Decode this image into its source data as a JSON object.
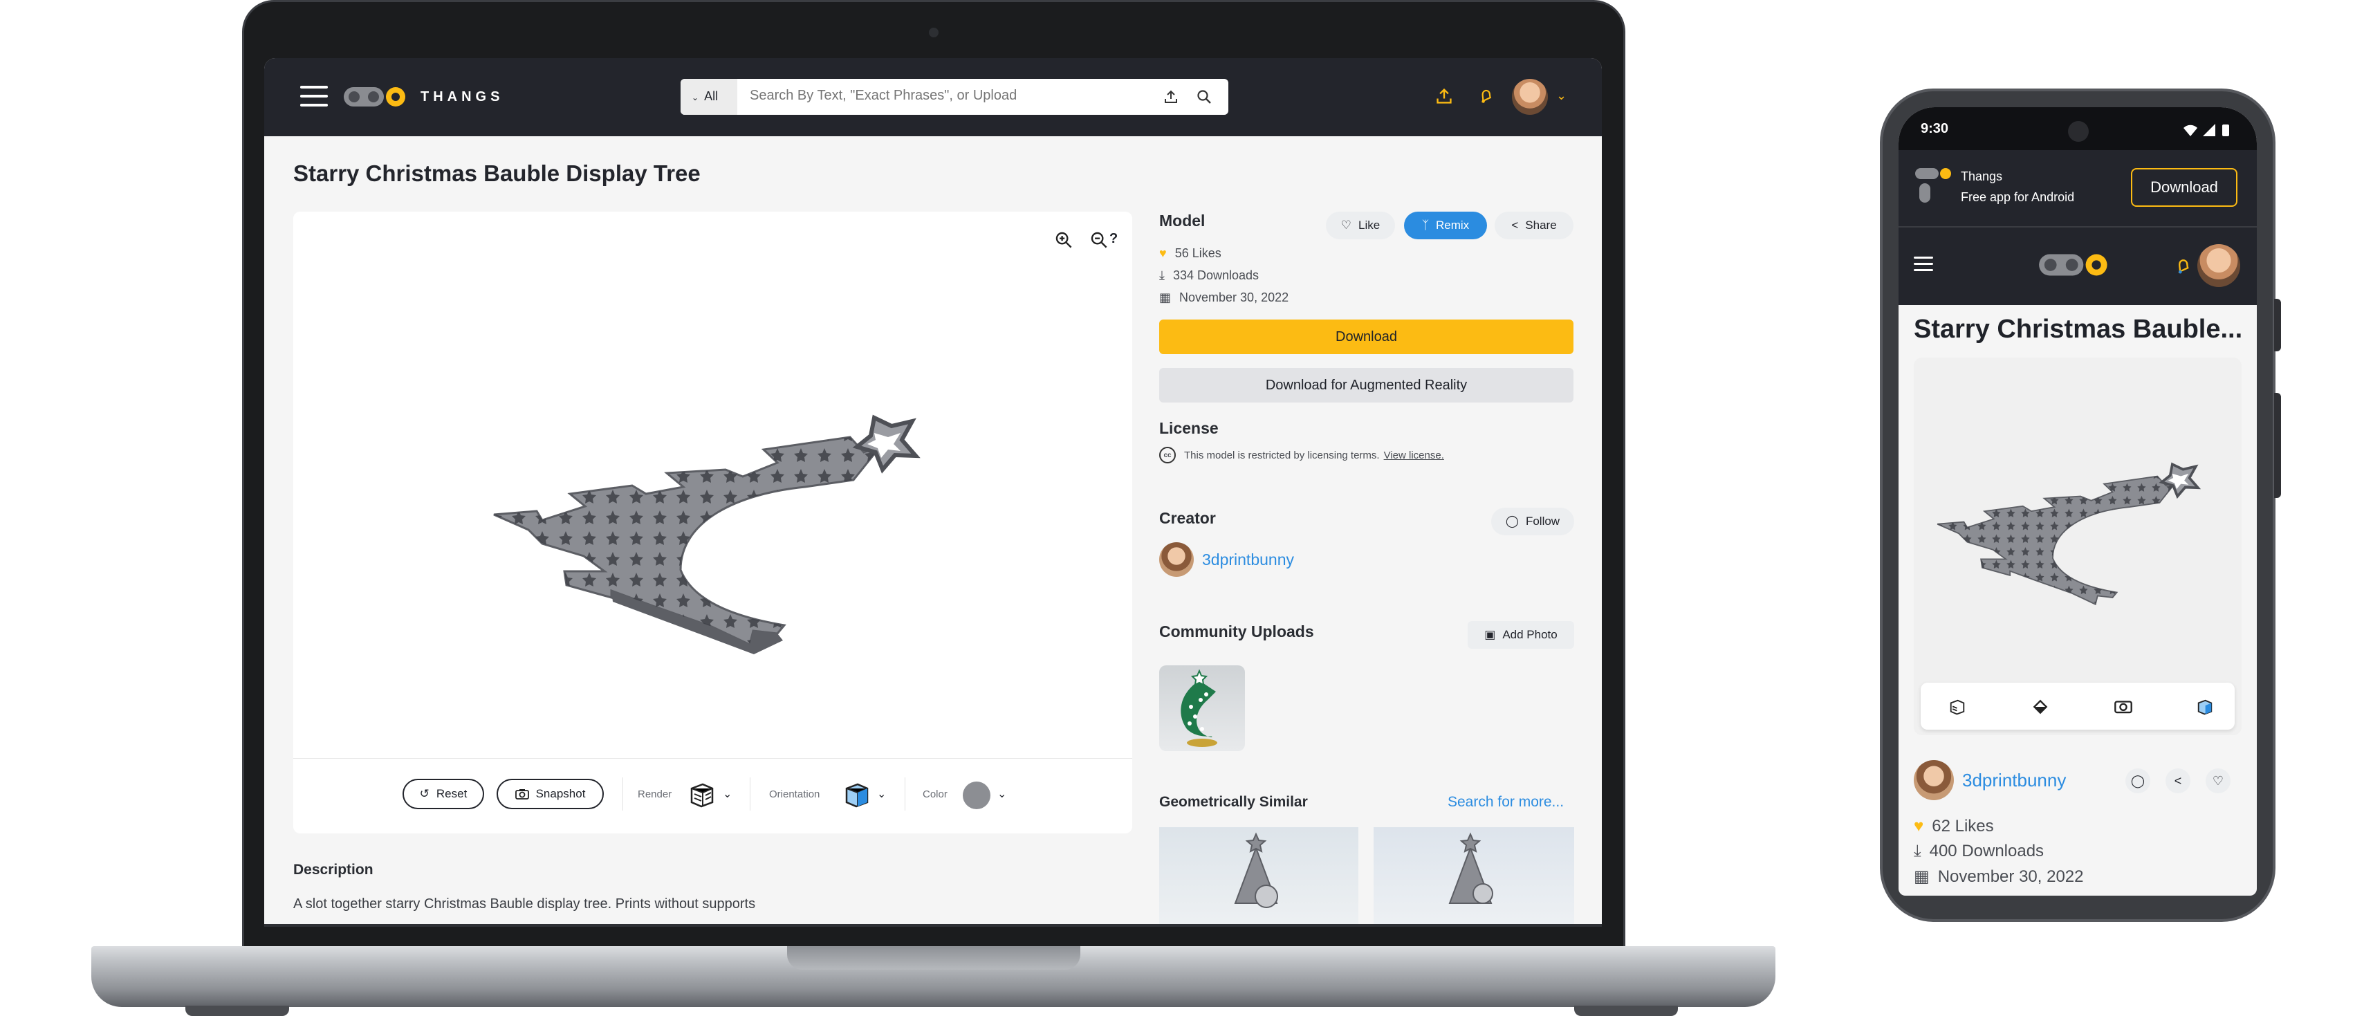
{
  "desktop": {
    "brand": "THANGS",
    "search": {
      "filter": "All",
      "placeholder": "Search By Text, \"Exact Phrases\", or Upload"
    },
    "title": "Starry Christmas Bauble Display Tree",
    "viewer": {
      "reset_label": "Reset",
      "snapshot_label": "Snapshot",
      "render_label": "Render",
      "orientation_label": "Orientation",
      "color_label": "Color",
      "help_label": "?"
    },
    "model": {
      "heading": "Model",
      "like_label": "Like",
      "remix_label": "Remix",
      "share_label": "Share",
      "likes": "56 Likes",
      "downloads": "334 Downloads",
      "date": "November 30, 2022",
      "download_label": "Download",
      "ar_download_label": "Download for Augmented Reality"
    },
    "license": {
      "heading": "License",
      "text": "This model is restricted by licensing terms.",
      "link": "View license.",
      "badge": "cc"
    },
    "creator": {
      "heading": "Creator",
      "follow_label": "Follow",
      "name": "3dprintbunny"
    },
    "community": {
      "heading": "Community Uploads",
      "add_photo_label": "Add Photo"
    },
    "similar": {
      "heading": "Geometrically Similar",
      "more_label": "Search for more..."
    },
    "description": {
      "heading": "Description",
      "text": "A slot together starry Christmas Bauble display tree. Prints without supports"
    }
  },
  "mobile": {
    "time": "9:30",
    "banner": {
      "app_name": "Thangs",
      "subtitle": "Free app for Android",
      "download_label": "Download"
    },
    "title": "Starry Christmas Bauble...",
    "creator_name": "3dprintbunny",
    "likes": "62 Likes",
    "downloads": "400 Downloads",
    "date": "November 30, 2022"
  },
  "colors": {
    "accent_yellow": "#fcbb13",
    "remix_blue": "#2b8ce0",
    "header_dark": "#23252c",
    "link_blue": "#2b8ce0"
  }
}
